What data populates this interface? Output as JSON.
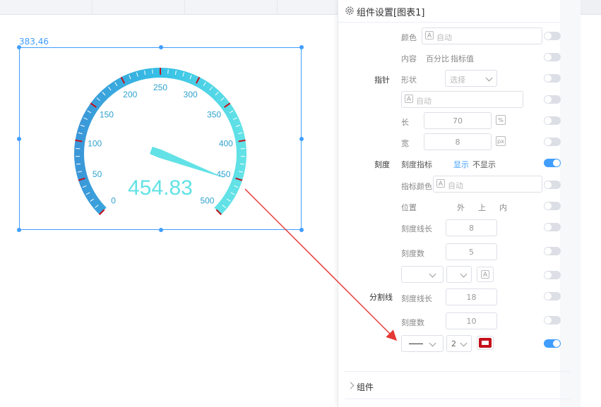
{
  "canvas": {
    "coords_label": "383,46"
  },
  "gauge": {
    "value": 454.83,
    "value_label": "454.83",
    "min": 0,
    "max": 500,
    "tick_labels": [
      "0",
      "50",
      "100",
      "150",
      "200",
      "250",
      "300",
      "350",
      "400",
      "450",
      "500"
    ],
    "colors": {
      "arc_low": "#3b97d8",
      "arc_high": "#62e2e6",
      "pointer": "#62e2e6",
      "value_text": "#62e2e6",
      "label_text": "#2fa2cf",
      "split_line": "#c4101c"
    }
  },
  "panel": {
    "title": "组件设置[图表1]",
    "close_icon": "×",
    "color_label": "颜色",
    "auto_text": "自动",
    "content_label": "内容",
    "content_options": [
      "百分比",
      "指标值"
    ],
    "pointer_section": "指针",
    "shape_label": "形状",
    "shape_placeholder": "选择",
    "length_label": "长",
    "length_value": "70",
    "length_unit": "%",
    "width_label": "宽",
    "width_value": "8",
    "width_unit": "px",
    "scale_section": "刻度",
    "scale_indicator_label": "刻度指标",
    "show_option": "显示",
    "hide_option": "不显示",
    "indicator_color_label": "指标颜色",
    "position_label": "位置",
    "position_options": [
      "外",
      "上",
      "内"
    ],
    "tick_length_label": "刻度线长",
    "tick_length_value": "8",
    "tick_count_label": "刻度数",
    "tick_count_value": "5",
    "split_section": "分割线",
    "split_length_label": "刻度线长",
    "split_length_value": "18",
    "split_count_label": "刻度数",
    "split_count_value": "10",
    "split_width_value": "2",
    "split_color": "#c4101c",
    "component_section": "组件",
    "accent_color": "#409eff"
  }
}
